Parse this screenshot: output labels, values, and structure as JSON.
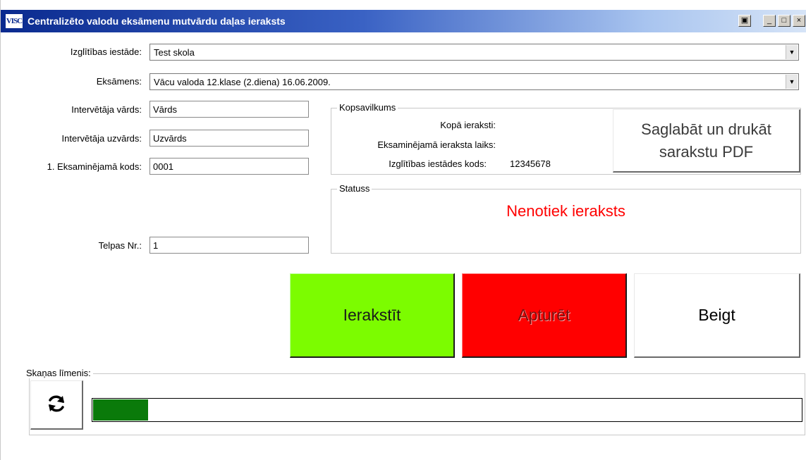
{
  "window": {
    "title": "Centralizēto valodu eksāmenu mutvārdu daļas ieraksts",
    "icon_text": "VISC",
    "buttons": {
      "extra": "▣",
      "minimize": "_",
      "maximize": "□",
      "close": "×"
    }
  },
  "form": {
    "school_label": "Izglītības iestāde:",
    "school_value": "Test skola",
    "exam_label": "Eksāmens:",
    "exam_value": "Vācu valoda 12.klase (2.diena) 16.06.2009.",
    "interviewer_name_label": "Intervētāja vārds:",
    "interviewer_name_value": "Vārds",
    "interviewer_surname_label": "Intervētāja uzvārds:",
    "interviewer_surname_value": "Uzvārds",
    "examinee_code_label": "1. Eksaminējamā kods:",
    "examinee_code_value": "0001",
    "room_label": "Telpas Nr.:",
    "room_value": "1"
  },
  "summary": {
    "legend": "Kopsavilkums",
    "total_label": "Kopā ieraksti:",
    "total_value": "",
    "time_label": "Eksaminējamā ieraksta laiks:",
    "time_value": "",
    "school_code_label": "Izglītības iestādes kods:",
    "school_code_value": "12345678",
    "pdf_button_line1": "Saglabāt un drukāt",
    "pdf_button_line2": "sarakstu PDF"
  },
  "status": {
    "legend": "Statuss",
    "text": "Nenotiek ieraksts",
    "color": "#ff0000"
  },
  "controls": {
    "record_label": "Ierakstīt",
    "stop_label": "Apturēt",
    "end_label": "Beigt",
    "record_color": "#7cfc00",
    "stop_color": "#ff0000"
  },
  "sound": {
    "legend": "Skaņas līmenis:",
    "refresh_icon": "refresh-icon",
    "level_fraction": 0.078,
    "meter_color": "#0a7a0a"
  }
}
